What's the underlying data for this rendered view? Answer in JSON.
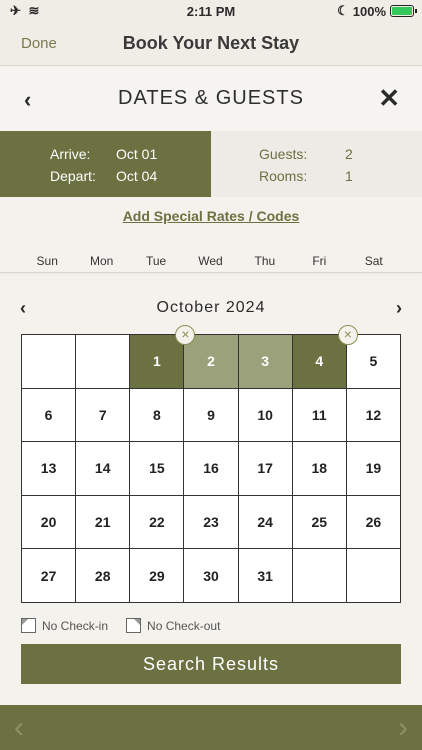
{
  "status": {
    "time": "2:11 PM",
    "battery": "100%",
    "battery_level": 1.0,
    "left_icons": "✈ ≋"
  },
  "nav": {
    "done": "Done",
    "title": "Book Your Next Stay"
  },
  "dates_guests": {
    "title": "DATES & GUESTS",
    "back_icon": "‹",
    "close_icon": "✕"
  },
  "summary": {
    "arrive_label": "Arrive:",
    "arrive_value": "Oct 01",
    "depart_label": "Depart:",
    "depart_value": "Oct 04",
    "guests_label": "Guests:",
    "guests_value": "2",
    "rooms_label": "Rooms:",
    "rooms_value": "1"
  },
  "add_rates": "Add Special Rates / Codes",
  "weekdays": [
    "Sun",
    "Mon",
    "Tue",
    "Wed",
    "Thu",
    "Fri",
    "Sat"
  ],
  "calendar": {
    "month": "October 2024",
    "prev_icon": "‹",
    "next_icon": "›",
    "cells": [
      {
        "day": "",
        "state": "empty"
      },
      {
        "day": "",
        "state": "empty"
      },
      {
        "day": "1",
        "state": "sel-end",
        "marker": true
      },
      {
        "day": "2",
        "state": "sel-mid"
      },
      {
        "day": "3",
        "state": "sel-mid"
      },
      {
        "day": "4",
        "state": "sel-end",
        "marker": true
      },
      {
        "day": "5",
        "state": ""
      },
      {
        "day": "6",
        "state": ""
      },
      {
        "day": "7",
        "state": ""
      },
      {
        "day": "8",
        "state": ""
      },
      {
        "day": "9",
        "state": ""
      },
      {
        "day": "10",
        "state": ""
      },
      {
        "day": "11",
        "state": ""
      },
      {
        "day": "12",
        "state": ""
      },
      {
        "day": "13",
        "state": ""
      },
      {
        "day": "14",
        "state": ""
      },
      {
        "day": "15",
        "state": ""
      },
      {
        "day": "16",
        "state": ""
      },
      {
        "day": "17",
        "state": ""
      },
      {
        "day": "18",
        "state": ""
      },
      {
        "day": "19",
        "state": ""
      },
      {
        "day": "20",
        "state": ""
      },
      {
        "day": "21",
        "state": ""
      },
      {
        "day": "22",
        "state": ""
      },
      {
        "day": "23",
        "state": ""
      },
      {
        "day": "24",
        "state": ""
      },
      {
        "day": "25",
        "state": ""
      },
      {
        "day": "26",
        "state": ""
      },
      {
        "day": "27",
        "state": ""
      },
      {
        "day": "28",
        "state": ""
      },
      {
        "day": "29",
        "state": ""
      },
      {
        "day": "30",
        "state": ""
      },
      {
        "day": "31",
        "state": ""
      },
      {
        "day": "",
        "state": "empty"
      },
      {
        "day": "",
        "state": "empty"
      }
    ]
  },
  "legend": {
    "no_checkin": "No Check-in",
    "no_checkout": "No Check-out"
  },
  "search_button": "Search Results",
  "bottom": {
    "prev_icon": "‹",
    "next_icon": "›"
  },
  "colors": {
    "accent": "#6b7141",
    "accent_light": "#9ba17b",
    "background": "#f4f2ec"
  }
}
